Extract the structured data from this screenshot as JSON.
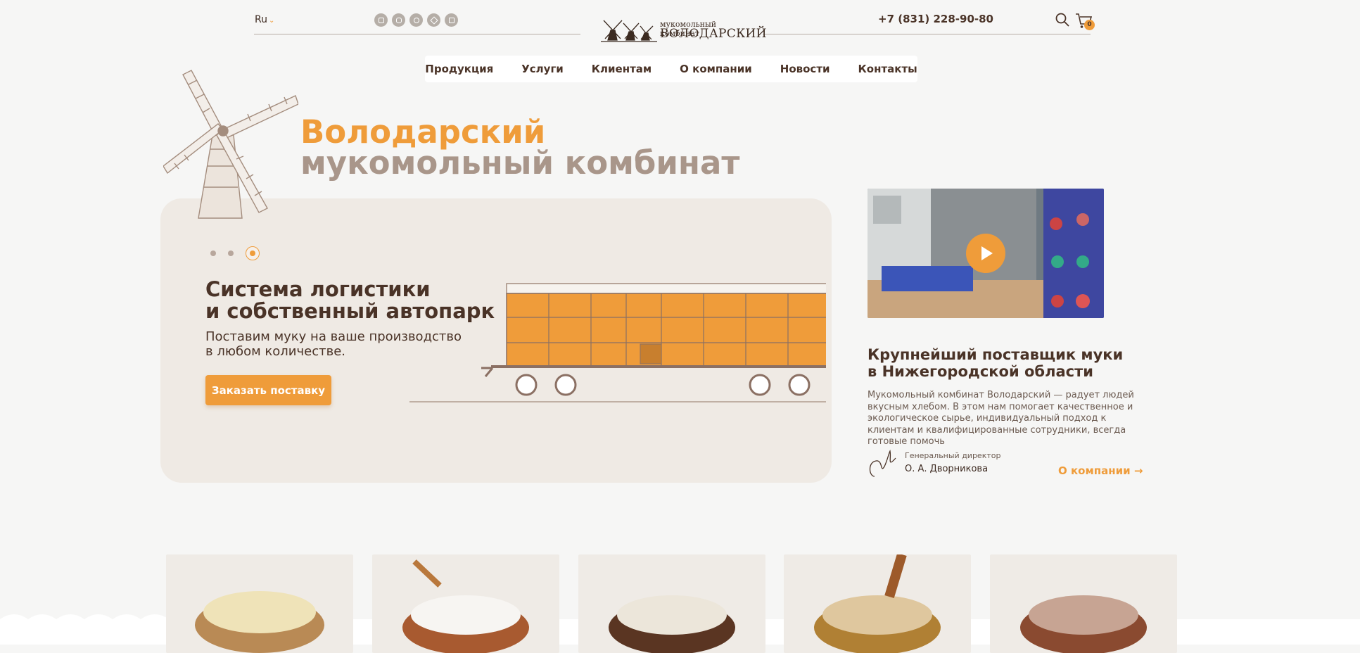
{
  "header": {
    "lang": "Ru",
    "logo": {
      "line1": "мукомольный комбинат",
      "line2": "ВОЛОДАРСКИЙ"
    },
    "phone": "+7 (831) 228-90-80",
    "cart_count": "0",
    "socials": [
      "youtube-icon",
      "instagram-icon",
      "chat-icon",
      "telegram-icon",
      "vk-icon"
    ]
  },
  "nav": {
    "items": [
      {
        "label": "Продукция"
      },
      {
        "label": "Услуги"
      },
      {
        "label": "Клиентам"
      },
      {
        "label": "О компании"
      },
      {
        "label": "Новости"
      },
      {
        "label": "Контакты"
      }
    ]
  },
  "hero": {
    "title_accent": "Володарский",
    "title_main": "мукомольный комбинат",
    "slide": {
      "active_index": 3,
      "total": 3,
      "heading_line1": "Система логистики",
      "heading_line2": "и собственный автопарк",
      "text": "Поставим муку на ваше производство в любом количестве.",
      "button": "Заказать поставку"
    }
  },
  "about": {
    "heading": "Крупнейший поставщик муки в Нижегородской области",
    "text": "Мукомольный комбинат Володарский — радует людей вкусным хлебом. В этом нам помогает качественное и экологическое сырье, индивидуальный подход к клиентам и квалифицированные сотрудники, всегда готовые помочь",
    "director_role": "Генеральный директор",
    "director_name": "О. А. Дворникова",
    "link": "О компании"
  },
  "colors": {
    "accent": "#ef9c3a",
    "text": "#4a3327",
    "muted": "#a9968a",
    "background": "#f6f6f5"
  }
}
